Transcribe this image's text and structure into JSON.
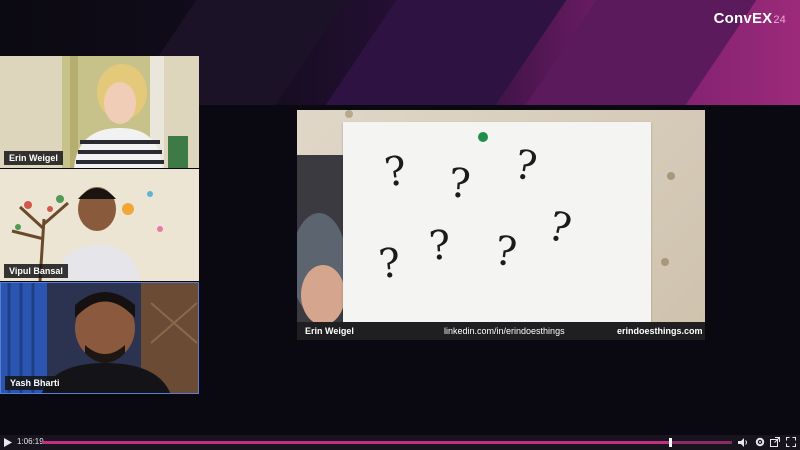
{
  "brand": {
    "logo_text": "ConvEX",
    "logo_year": "24"
  },
  "participants": [
    {
      "name": "Erin Weigel"
    },
    {
      "name": "Vipul Bansal"
    },
    {
      "name": "Yash Bharti"
    }
  ],
  "shared_screen": {
    "presenter_name": "Erin Weigel",
    "link_text": "linkedin.com/in/erindoesthings",
    "site_text": "erindoesthings.com",
    "question_marks": [
      "?",
      "?",
      "?",
      "?",
      "?",
      "?",
      "?"
    ]
  },
  "player": {
    "current_time": "1:06:19",
    "progress": 0.91,
    "icons": [
      "play-icon",
      "volume-icon",
      "settings-icon",
      "popout-icon",
      "fullscreen-icon"
    ]
  },
  "colors": {
    "accent": "#c22f87",
    "pin_green": "#1f8f4a"
  }
}
